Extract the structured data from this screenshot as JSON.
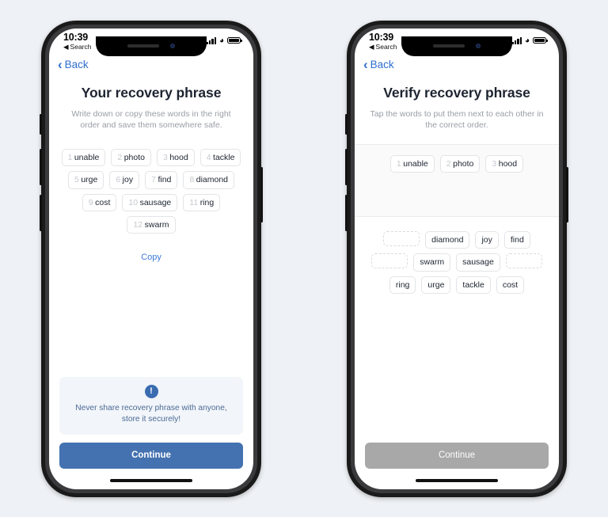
{
  "page": {
    "background_color": "#eef1f5"
  },
  "status_bar": {
    "time": "10:39",
    "back_app_label": "Search",
    "back_app_arrow": "◀",
    "icons": [
      "signal-bars",
      "wifi",
      "battery"
    ]
  },
  "nav": {
    "back_label": "Back",
    "back_chevron": "‹",
    "accent_color": "#2f6fd0"
  },
  "screens": [
    {
      "id": "recovery-phrase",
      "title": "Your recovery phrase",
      "subtitle": "Write down or copy these words in the right order and save them somewhere safe.",
      "words": [
        {
          "num": "1",
          "word": "unable"
        },
        {
          "num": "2",
          "word": "photo"
        },
        {
          "num": "3",
          "word": "hood"
        },
        {
          "num": "4",
          "word": "tackle"
        },
        {
          "num": "5",
          "word": "urge"
        },
        {
          "num": "6",
          "word": "joy"
        },
        {
          "num": "7",
          "word": "find"
        },
        {
          "num": "8",
          "word": "diamond"
        },
        {
          "num": "9",
          "word": "cost"
        },
        {
          "num": "10",
          "word": "sausage"
        },
        {
          "num": "11",
          "word": "ring"
        },
        {
          "num": "12",
          "word": "swarm"
        }
      ],
      "copy_label": "Copy",
      "warning": {
        "icon": "info-exclamation-icon",
        "text": "Never share recovery phrase with anyone, store it securely!",
        "background_color": "#f2f5f9",
        "text_color": "#4b6a96",
        "icon_color": "#3b6cb0"
      },
      "cta": {
        "label": "Continue",
        "enabled": true,
        "color": "#4472b0"
      }
    },
    {
      "id": "verify-phrase",
      "title": "Verify recovery phrase",
      "subtitle": "Tap the words to put them next to each other in the correct order.",
      "selected_words": [
        {
          "num": "1",
          "word": "unable"
        },
        {
          "num": "2",
          "word": "photo"
        },
        {
          "num": "3",
          "word": "hood"
        }
      ],
      "pool_words": [
        {
          "word": "",
          "empty": true
        },
        {
          "word": "diamond",
          "empty": false
        },
        {
          "word": "joy",
          "empty": false
        },
        {
          "word": "find",
          "empty": false
        },
        {
          "word": "",
          "empty": true
        },
        {
          "word": "swarm",
          "empty": false
        },
        {
          "word": "sausage",
          "empty": false
        },
        {
          "word": "",
          "empty": true
        },
        {
          "word": "ring",
          "empty": false
        },
        {
          "word": "urge",
          "empty": false
        },
        {
          "word": "tackle",
          "empty": false
        },
        {
          "word": "cost",
          "empty": false
        }
      ],
      "cta": {
        "label": "Continue",
        "enabled": false,
        "color": "#a8a8a8"
      }
    }
  ]
}
